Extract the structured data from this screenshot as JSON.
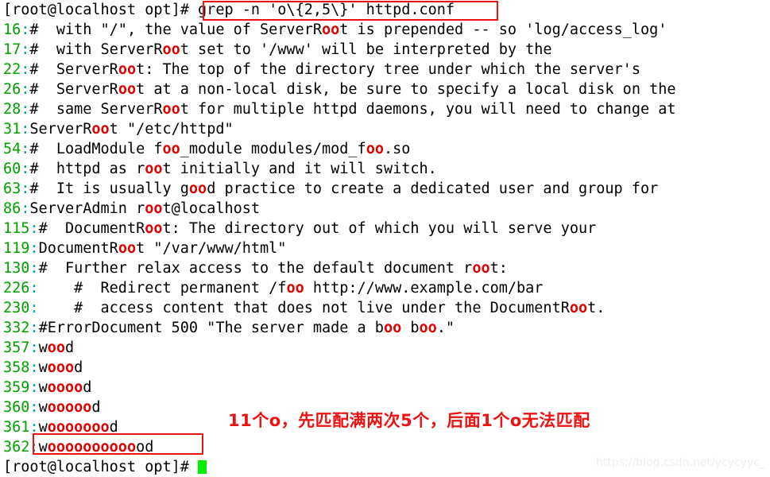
{
  "terminal": {
    "prompt": "[root@localhost opt]#",
    "command": "grep -n 'o\\{2,5\\}' httpd.conf",
    "final_prompt": "[root@localhost opt]#",
    "colors": {
      "line_number": "#00a000",
      "colon": "#00a0a0",
      "match_highlight": "#e00000",
      "text": "#000000",
      "background": "#ffffff",
      "annotation": "#ee1111",
      "box_border": "#ee1111",
      "cursor": "#00ee00"
    },
    "results": [
      {
        "lineno": "16",
        "segments": [
          {
            "t": "#  with \"/\", the value of ServerR",
            "c": "plain"
          },
          {
            "t": "oo",
            "c": "hl"
          },
          {
            "t": "t is prepended -- so 'log/access_log'",
            "c": "plain"
          }
        ]
      },
      {
        "lineno": "17",
        "segments": [
          {
            "t": "#  with ServerR",
            "c": "plain"
          },
          {
            "t": "oo",
            "c": "hl"
          },
          {
            "t": "t set to '/www' will be interpreted by the",
            "c": "plain"
          }
        ]
      },
      {
        "lineno": "22",
        "segments": [
          {
            "t": "#  ServerR",
            "c": "plain"
          },
          {
            "t": "oo",
            "c": "hl"
          },
          {
            "t": "t: The top of the directory tree under which the server's",
            "c": "plain"
          }
        ]
      },
      {
        "lineno": "26",
        "segments": [
          {
            "t": "#  ServerR",
            "c": "plain"
          },
          {
            "t": "oo",
            "c": "hl"
          },
          {
            "t": "t at a non-local disk, be sure to specify a local disk on the",
            "c": "plain"
          }
        ]
      },
      {
        "lineno": "28",
        "segments": [
          {
            "t": "#  same ServerR",
            "c": "plain"
          },
          {
            "t": "oo",
            "c": "hl"
          },
          {
            "t": "t for multiple httpd daemons, you will need to change at",
            "c": "plain"
          }
        ]
      },
      {
        "lineno": "31",
        "segments": [
          {
            "t": "ServerR",
            "c": "plain"
          },
          {
            "t": "oo",
            "c": "hl"
          },
          {
            "t": "t \"/etc/httpd\"",
            "c": "plain"
          }
        ]
      },
      {
        "lineno": "54",
        "segments": [
          {
            "t": "#  LoadModule f",
            "c": "plain"
          },
          {
            "t": "oo",
            "c": "hl"
          },
          {
            "t": "_module modules/mod_f",
            "c": "plain"
          },
          {
            "t": "oo",
            "c": "hl"
          },
          {
            "t": ".so",
            "c": "plain"
          }
        ]
      },
      {
        "lineno": "60",
        "segments": [
          {
            "t": "#  httpd as r",
            "c": "plain"
          },
          {
            "t": "oo",
            "c": "hl"
          },
          {
            "t": "t initially and it will switch.",
            "c": "plain"
          }
        ]
      },
      {
        "lineno": "63",
        "segments": [
          {
            "t": "#  It is usually g",
            "c": "plain"
          },
          {
            "t": "oo",
            "c": "hl"
          },
          {
            "t": "d practice to create a dedicated user and group for",
            "c": "plain"
          }
        ]
      },
      {
        "lineno": "86",
        "segments": [
          {
            "t": "ServerAdmin r",
            "c": "plain"
          },
          {
            "t": "oo",
            "c": "hl"
          },
          {
            "t": "t@localhost",
            "c": "plain"
          }
        ]
      },
      {
        "lineno": "115",
        "segments": [
          {
            "t": "#  DocumentR",
            "c": "plain"
          },
          {
            "t": "oo",
            "c": "hl"
          },
          {
            "t": "t: The directory out of which you will serve your",
            "c": "plain"
          }
        ]
      },
      {
        "lineno": "119",
        "segments": [
          {
            "t": "DocumentR",
            "c": "plain"
          },
          {
            "t": "oo",
            "c": "hl"
          },
          {
            "t": "t \"/var/www/html\"",
            "c": "plain"
          }
        ]
      },
      {
        "lineno": "130",
        "segments": [
          {
            "t": "#  Further relax access to the default document r",
            "c": "plain"
          },
          {
            "t": "oo",
            "c": "hl"
          },
          {
            "t": "t:",
            "c": "plain"
          }
        ]
      },
      {
        "lineno": "226",
        "segments": [
          {
            "t": "    #  Redirect permanent /f",
            "c": "plain"
          },
          {
            "t": "oo",
            "c": "hl"
          },
          {
            "t": " http://www.example.com/bar",
            "c": "plain"
          }
        ]
      },
      {
        "lineno": "230",
        "segments": [
          {
            "t": "    #  access content that does not live under the DocumentR",
            "c": "plain"
          },
          {
            "t": "oo",
            "c": "hl"
          },
          {
            "t": "t.",
            "c": "plain"
          }
        ]
      },
      {
        "lineno": "332",
        "segments": [
          {
            "t": "#ErrorDocument 500 \"The server made a b",
            "c": "plain"
          },
          {
            "t": "oo",
            "c": "hl"
          },
          {
            "t": " b",
            "c": "plain"
          },
          {
            "t": "oo",
            "c": "hl"
          },
          {
            "t": ".\"",
            "c": "plain"
          }
        ]
      },
      {
        "lineno": "357",
        "segments": [
          {
            "t": "w",
            "c": "plain"
          },
          {
            "t": "oo",
            "c": "hl"
          },
          {
            "t": "d",
            "c": "plain"
          }
        ]
      },
      {
        "lineno": "358",
        "segments": [
          {
            "t": "w",
            "c": "plain"
          },
          {
            "t": "ooo",
            "c": "hl"
          },
          {
            "t": "d",
            "c": "plain"
          }
        ]
      },
      {
        "lineno": "359",
        "segments": [
          {
            "t": "w",
            "c": "plain"
          },
          {
            "t": "oooo",
            "c": "hl"
          },
          {
            "t": "d",
            "c": "plain"
          }
        ]
      },
      {
        "lineno": "360",
        "segments": [
          {
            "t": "w",
            "c": "plain"
          },
          {
            "t": "ooooo",
            "c": "hl"
          },
          {
            "t": "d",
            "c": "plain"
          }
        ]
      },
      {
        "lineno": "361",
        "segments": [
          {
            "t": "w",
            "c": "plain"
          },
          {
            "t": "ooooooo",
            "c": "hl"
          },
          {
            "t": "d",
            "c": "plain"
          }
        ]
      },
      {
        "lineno": "362",
        "segments": [
          {
            "t": "w",
            "c": "plain"
          },
          {
            "t": "oooooooooo",
            "c": "hl"
          },
          {
            "t": "od",
            "c": "plain"
          }
        ]
      }
    ],
    "annotation": "11个o，先匹配满两次5个，后面1个o无法匹配",
    "watermark": "https://blog.csdn.net/ycycyyc_"
  }
}
